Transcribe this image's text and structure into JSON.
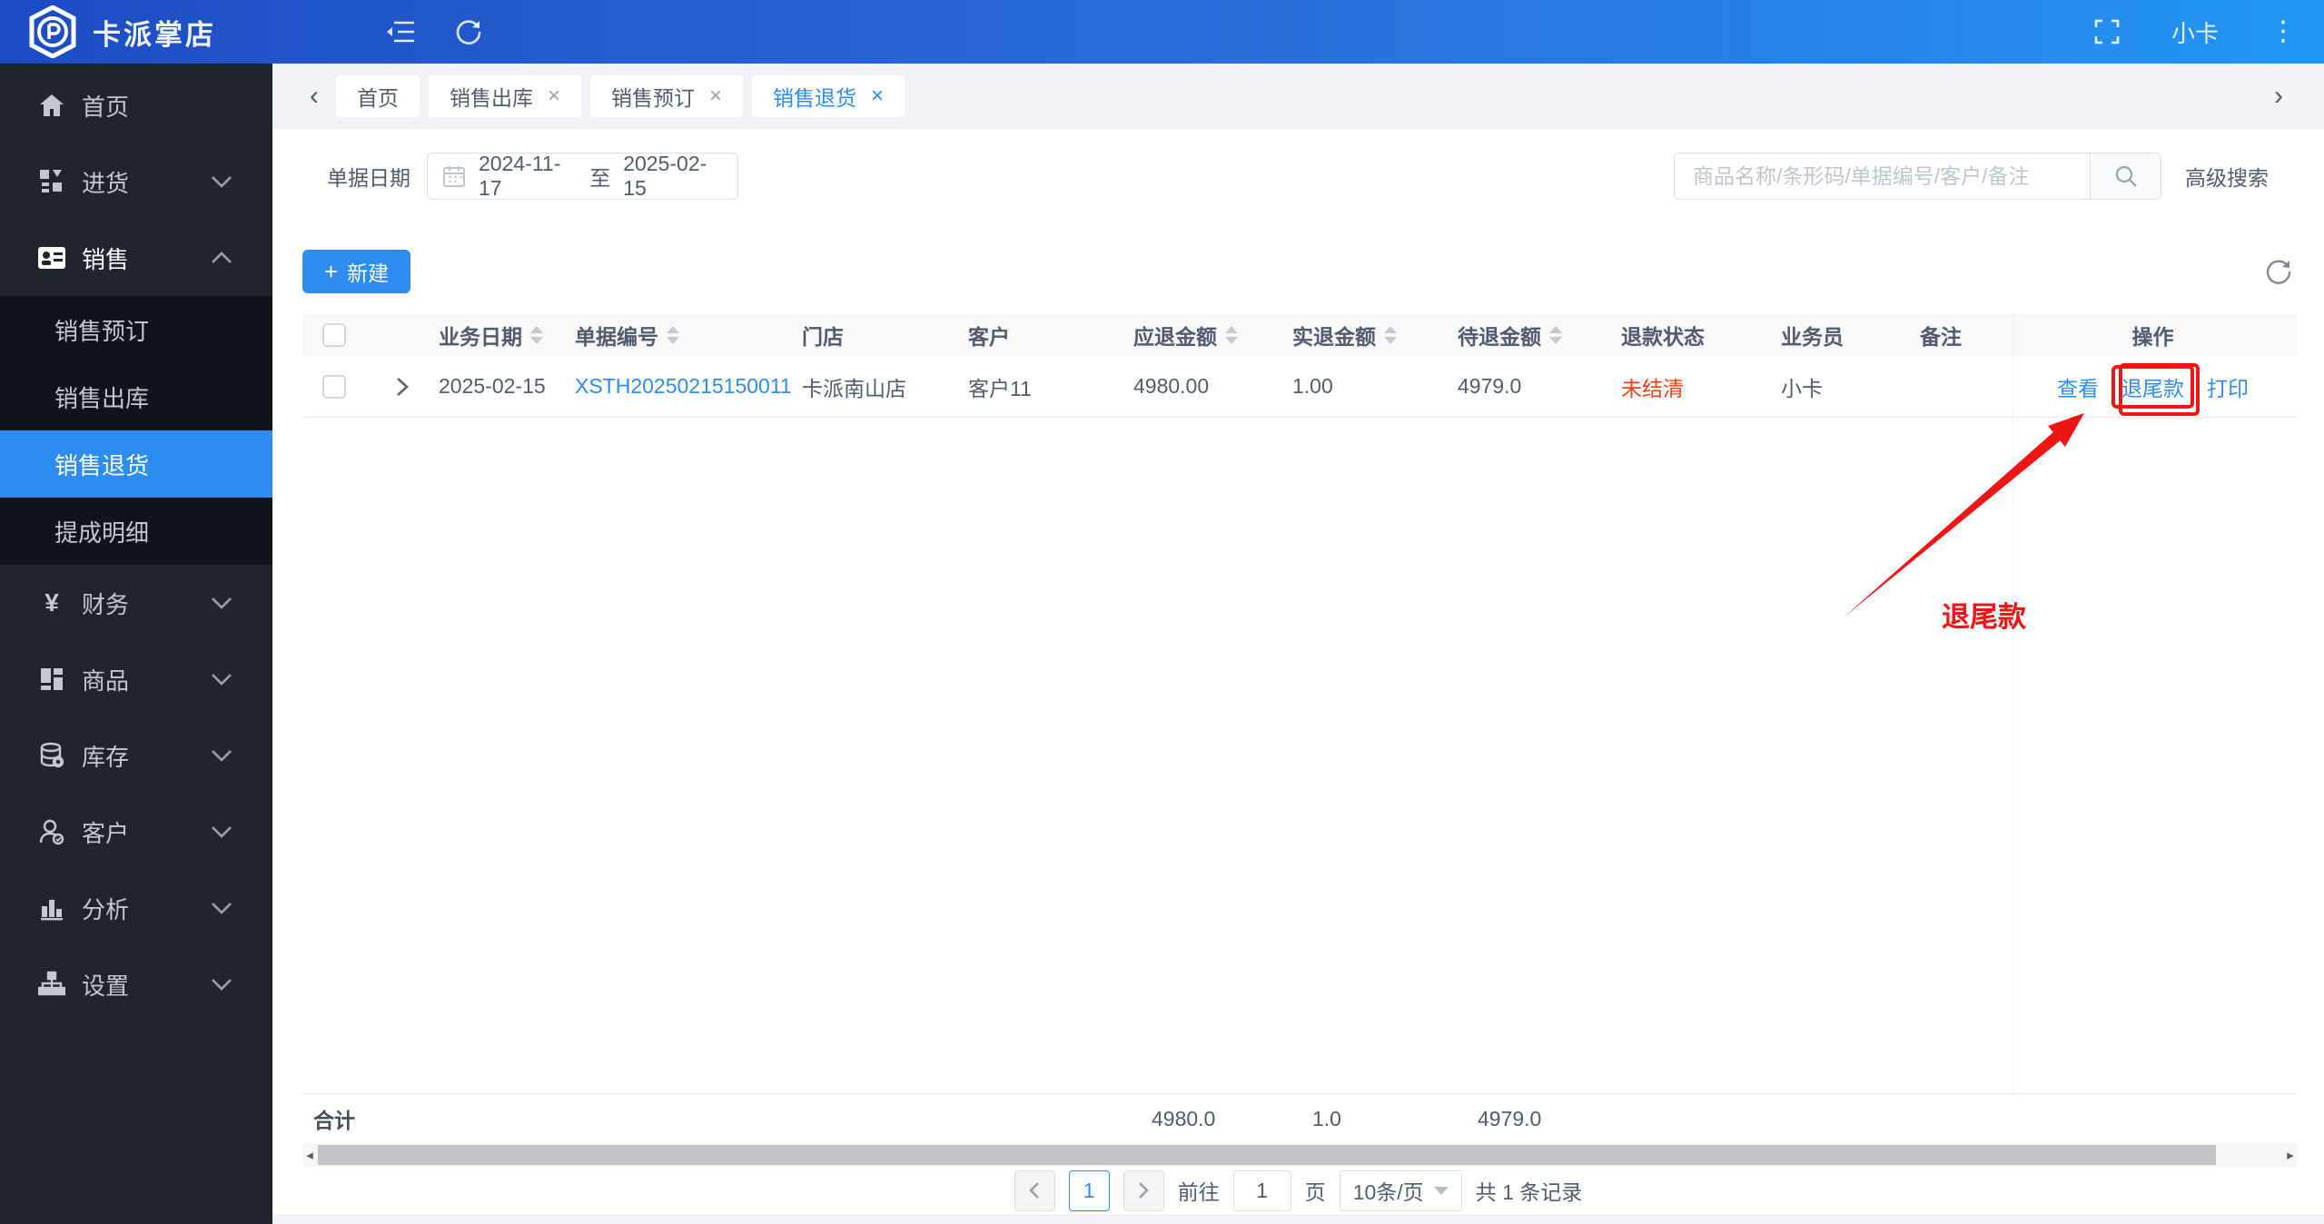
{
  "topbar": {
    "brand": "卡派掌店",
    "user": "小卡"
  },
  "glyphs": {
    "close": "×",
    "plus": "+",
    "dots": "⋮",
    "yen": "¥",
    "scroll_left": "◂",
    "scroll_right": "▸",
    "tab_prev": "‹",
    "tab_next": "›"
  },
  "sidebar": {
    "items": [
      {
        "label": "首页"
      },
      {
        "label": "进货"
      },
      {
        "label": "销售"
      },
      {
        "label": "财务"
      },
      {
        "label": "商品"
      },
      {
        "label": "库存"
      },
      {
        "label": "客户"
      },
      {
        "label": "分析"
      },
      {
        "label": "设置"
      }
    ],
    "sales_submenu": [
      {
        "label": "销售预订"
      },
      {
        "label": "销售出库"
      },
      {
        "label": "销售退货"
      },
      {
        "label": "提成明细"
      }
    ]
  },
  "tabs": [
    {
      "label": "首页"
    },
    {
      "label": "销售出库"
    },
    {
      "label": "销售预订"
    },
    {
      "label": "销售退货"
    }
  ],
  "filter": {
    "date_label": "单据日期",
    "date_start": "2024-11-17",
    "date_separator": "至",
    "date_end": "2025-02-15",
    "search_placeholder": "商品名称/条形码/单据编号/客户/备注",
    "advanced_search": "高级搜索"
  },
  "toolbar": {
    "new_button": "新建"
  },
  "table": {
    "headers": {
      "biz_date": "业务日期",
      "doc_no": "单据编号",
      "store": "门店",
      "customer": "客户",
      "refund_due": "应退金额",
      "refund_actual": "实退金额",
      "refund_pending": "待退金额",
      "refund_status": "退款状态",
      "salesperson": "业务员",
      "remark": "备注",
      "actions": "操作"
    },
    "row": {
      "biz_date": "2025-02-15",
      "doc_no": "XSTH20250215150011",
      "store": "卡派南山店",
      "customer": "客户11",
      "refund_due": "4980.00",
      "refund_actual": "1.00",
      "refund_pending": "4979.0",
      "refund_status": "未结清",
      "salesperson": "小卡",
      "remark": "",
      "actions": {
        "view": "查看",
        "refund_balance": "退尾款",
        "print": "打印"
      }
    },
    "totals": {
      "label": "合计",
      "refund_due": "4980.0",
      "refund_actual": "1.0",
      "refund_pending": "4979.0"
    }
  },
  "annotation": {
    "label": "退尾款"
  },
  "pagination": {
    "current_page": "1",
    "goto_label": "前往",
    "goto_value": "1",
    "page_unit": "页",
    "page_size": "10条/页",
    "total_text": "共 1 条记录"
  },
  "colors": {
    "accent": "#2d8cf0",
    "status_red": "#ed4014",
    "annotation_red": "#f01414",
    "topbar_left": "#1d4cc2",
    "topbar_right": "#2196f3"
  }
}
